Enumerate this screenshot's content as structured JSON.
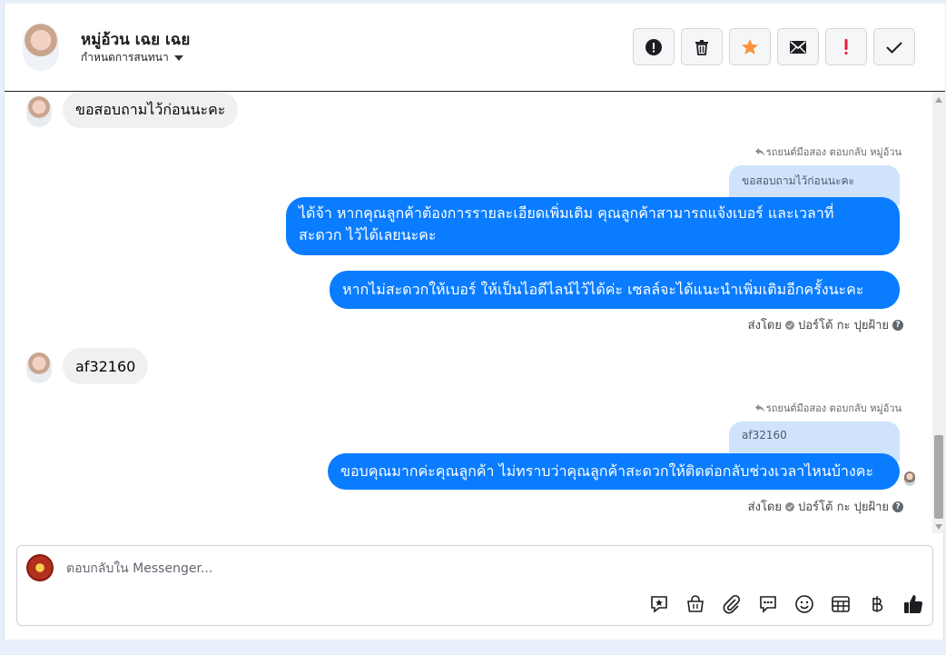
{
  "header": {
    "name": "หมู่อ้วน เฉย เฉย",
    "subtitle": "กำหนดการสนทนา"
  },
  "actions": [
    {
      "icon": "alert-circle-icon"
    },
    {
      "icon": "trash-icon"
    },
    {
      "icon": "star-icon",
      "color": "#f7923b"
    },
    {
      "icon": "envelope-icon"
    },
    {
      "icon": "exclamation-icon",
      "color": "#e41e3f"
    },
    {
      "icon": "check-icon"
    }
  ],
  "messages": {
    "in1": "ขอสอบถามไว้ก่อนนะคะ",
    "reply1_meta": "รถยนต์มือสอง ตอบกลับ หมู่อ้วน",
    "reply1_quote": "ขอสอบถามไว้ก่อนนะคะ",
    "out1_line1": "ได้จ้า หากคุณลูกค้าต้องการรายละเอียดเพิ่มเติม คุณลูกค้าสามารถแจ้งเบอร์ และเวลาที่",
    "out1_line2": "สะดวก ไว้ได้เลยนะคะ",
    "out2": "หากไม่สะดวกให้เบอร์  ให้เป็นไอดีไลน์ไว้ได้ค่ะ  เซลล์จะได้แนะนำเพิ่มเติมอีกครั้งนะคะ",
    "sentby1": "ส่งโดย",
    "sender1": "ปอร์โต้ กะ ปุยฝ้าย",
    "in2": "af32160",
    "reply2_meta": "รถยนต์มือสอง ตอบกลับ หมู่อ้วน",
    "reply2_quote": "af32160",
    "out3": "ขอบคุณมากค่ะคุณลูกค้า ไม่ทราบว่าคุณลูกค้าสะดวกให้ติดต่อกลับช่วงเวลาไหนบ้างคะ",
    "sentby2": "ส่งโดย",
    "sender2": "ปอร์โต้ กะ ปุยฝ้าย"
  },
  "composer": {
    "placeholder": "ตอบกลับใน Messenger...",
    "tools": [
      "sticker-icon",
      "shopping-bag-icon",
      "paperclip-icon",
      "chat-bubble-icon",
      "smiley-icon",
      "table-icon",
      "baht-icon",
      "thumbs-up-icon"
    ]
  },
  "colors": {
    "outgoing": "#0a7cff",
    "incoming": "#f0f0f0",
    "quote": "#cfe3fb"
  }
}
